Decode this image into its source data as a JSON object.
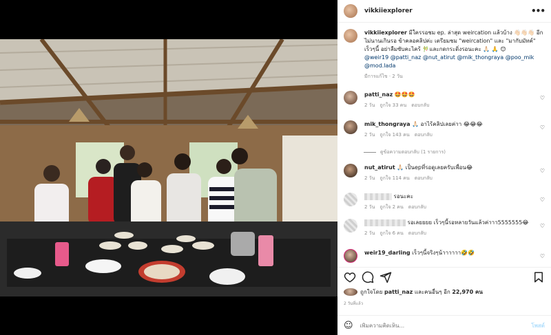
{
  "post": {
    "username": "vikkiiexplorer",
    "more_label": "•••",
    "caption": "มีใครรอชม ep. ล่าสุด weircation แล้วบ้าง 👋🏻👋🏻👋🏻 อีกไม่นานเกินรอ ข้าคลอคลิปค่ะ เตรียมชม \"weircation\" และ \"มากับมัทค์\" เร็วๆนี้ อย่าลืมซับคะไคร้ 🎋และกดกระดิ่งรอนะคะ 🙏🏻 🙏 😊",
    "caption_tags": "@weir19 @patti_naz @nut_atirut @mik_thongraya @poo_mik @mod.lada",
    "caption_meta": "มีการแก้ไข · 2 วัน"
  },
  "comments": [
    {
      "user": "patti_naz",
      "text": "🤩🤩🤩",
      "time": "2 วัน",
      "likes": "ถูกใจ 33 คน",
      "reply": "ตอบกลับ"
    },
    {
      "user": "mik_thongraya",
      "text": "🙏🏻 อาไร้คลิปเลยค่าา 😂😂😂",
      "time": "2 วัน",
      "likes": "ถูกใจ 143 คน",
      "reply": "ตอบกลับ"
    },
    {
      "user": "nut_atirut",
      "text": "🙏🏻 เป็นepที่รอดูเลยครับเพื่อน😂",
      "time": "2 วัน",
      "likes": "ถูกใจ 114 คน",
      "reply": "ตอบกลับ"
    },
    {
      "user": "",
      "text": "รอนะคะ",
      "time": "2 วัน",
      "likes": "ถูกใจ 2 คน",
      "reply": "ตอบกลับ"
    },
    {
      "user": "",
      "text": "รอเลยยยย เร็วๆนี้รอหลายวันแล้วค่าาา5555555😂",
      "time": "2 วัน",
      "likes": "ถูกใจ 6 คน",
      "reply": "ตอบกลับ"
    },
    {
      "user": "weir19_darling",
      "text": "เร็วๆนี้จริงๆน้าาาาาา🤣🤣",
      "time": "",
      "likes": "",
      "reply": ""
    }
  ],
  "view_replies": "ดูข้อความตอบกลับ (1 รายการ)",
  "likes": {
    "prefix": "ถูกใจโดย",
    "user": "patti_naz",
    "middle": "และคนอื่นๆ อีก",
    "count": "22,970 คน"
  },
  "date": "2 วันที่แล้ว",
  "composer": {
    "placeholder": "เพิ่มความคิดเห็น...",
    "post_label": "โพสต์",
    "emoji": "☺"
  },
  "colors": {
    "link": "#00376b",
    "muted": "#8e8e8e",
    "post_disabled": "#b2dffc"
  }
}
